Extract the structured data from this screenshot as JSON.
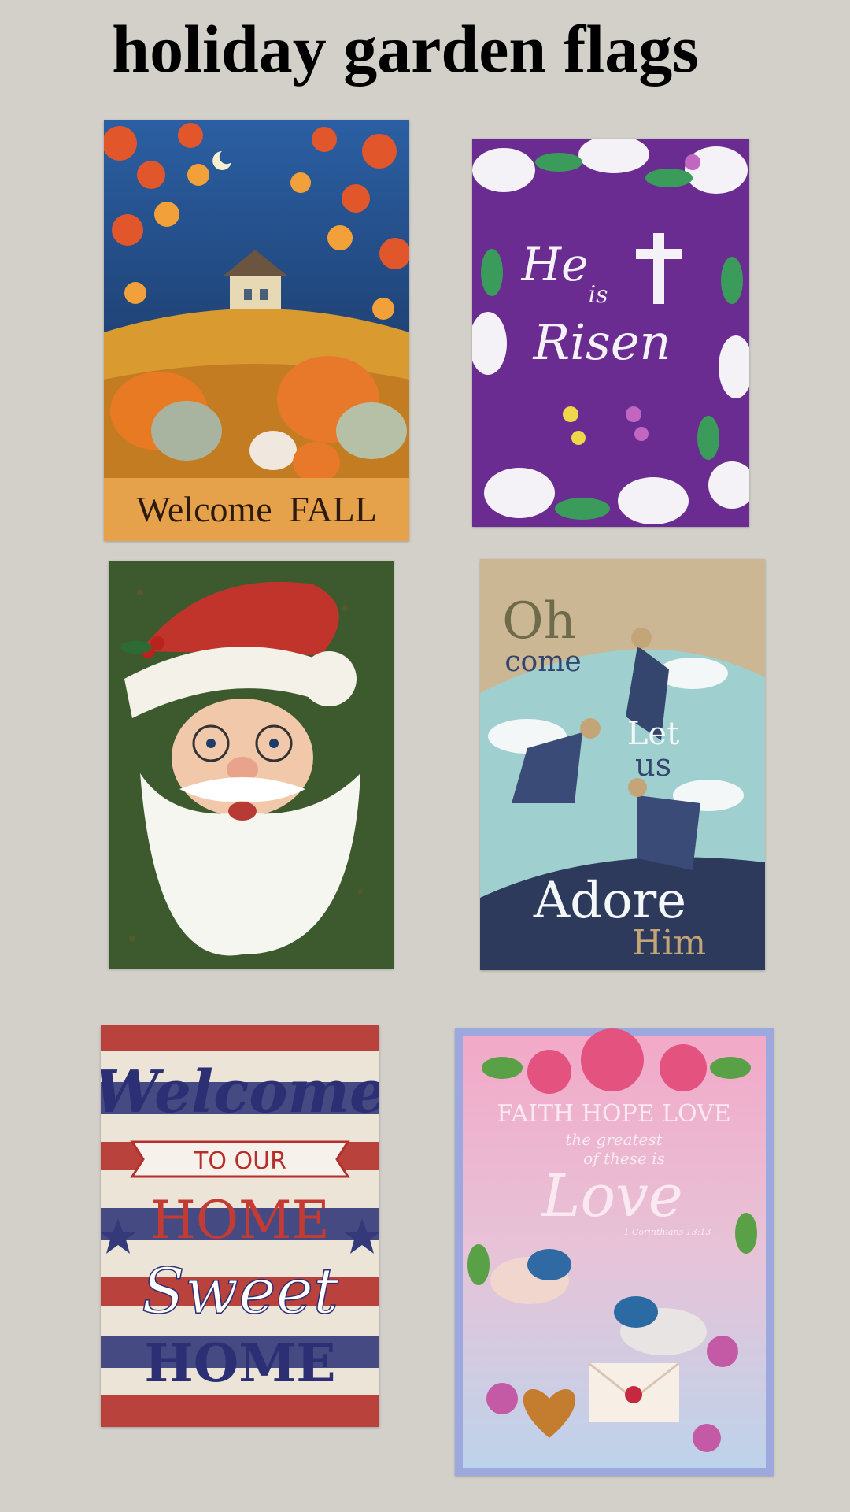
{
  "page": {
    "title": "holiday garden flags"
  },
  "flags": [
    {
      "lines": [
        "Welcome",
        "FALL"
      ]
    },
    {
      "lines": [
        "He",
        "is",
        "Risen"
      ]
    },
    {
      "lines": []
    },
    {
      "lines": [
        "Oh",
        "come",
        "Let",
        "us",
        "Adore",
        "Him"
      ]
    },
    {
      "lines": [
        "Welcome",
        "TO OUR",
        "HOME",
        "Sweet",
        "HOME"
      ]
    },
    {
      "lines": [
        "FAITH HOPE LOVE",
        "the greatest",
        "of these is",
        "Love",
        "1 Corinthians 13:13"
      ]
    }
  ],
  "colors": {
    "background": "#d3d0ca",
    "fall_sky": "#1f3d6e",
    "easter_purple": "#6a2c91",
    "santa_green": "#3d5a2f",
    "advent_teal": "#9fd0cf",
    "patriotic_red": "#b5302c",
    "love_pink": "#f2a9c8"
  }
}
